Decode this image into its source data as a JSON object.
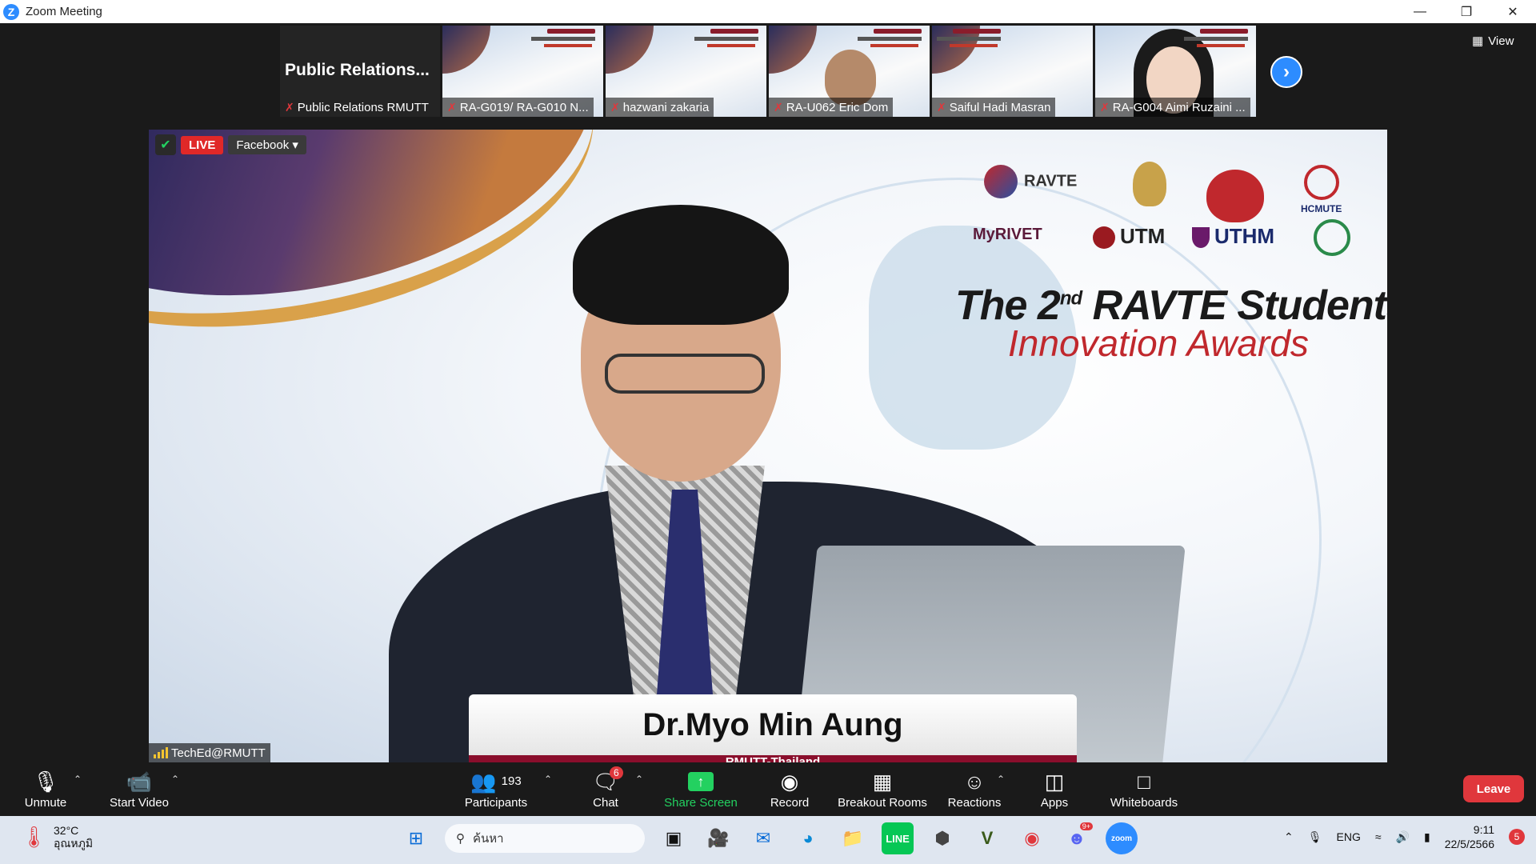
{
  "window": {
    "title": "Zoom Meeting",
    "icon": "zoom-logo-icon"
  },
  "strip": {
    "tiles": [
      {
        "big": "Public  Relations...",
        "name": "Public Relations RMUTT"
      },
      {
        "name": "RA-G019/ RA-G010 N..."
      },
      {
        "name": "hazwani zakaria"
      },
      {
        "name": "RA-U062 Eric Dom"
      },
      {
        "name": "Saiful Hadi Masran"
      },
      {
        "name": "RA-G004 Aimi Ruzaini ..."
      }
    ],
    "view_label": "View"
  },
  "video": {
    "live_label": "LIVE",
    "stream_target": "Facebook",
    "logos": [
      "RAVTE",
      "HCMUTE",
      "MyRIVET",
      "UTM",
      "UTHM"
    ],
    "event_title_line1": "The 2",
    "event_title_sup": "nd",
    "event_title_line1b": " RAVTE Students",
    "event_title_line2": "Innovation Awards",
    "speaker_name": "Dr.Myo Min Aung",
    "speaker_affiliation": "RMUTT-Thailand",
    "active_speaker": "TechEd@RMUTT"
  },
  "toolbar": {
    "unmute": "Unmute",
    "start_video": "Start Video",
    "participants": "Participants",
    "participants_count": "193",
    "chat": "Chat",
    "chat_badge": "6",
    "share_screen": "Share Screen",
    "record": "Record",
    "breakout_rooms": "Breakout Rooms",
    "reactions": "Reactions",
    "apps": "Apps",
    "whiteboards": "Whiteboards",
    "leave": "Leave"
  },
  "taskbar": {
    "temperature": "32°C",
    "weather_label": "อุณหภูมิ",
    "search_placeholder": "ค้นหา",
    "language": "ENG",
    "time": "9:11",
    "date": "22/5/2566",
    "notification_count": "5",
    "discord_badge": "9+"
  },
  "colors": {
    "accent": "#2d8cff",
    "danger": "#e0373c",
    "share": "#23d160"
  }
}
